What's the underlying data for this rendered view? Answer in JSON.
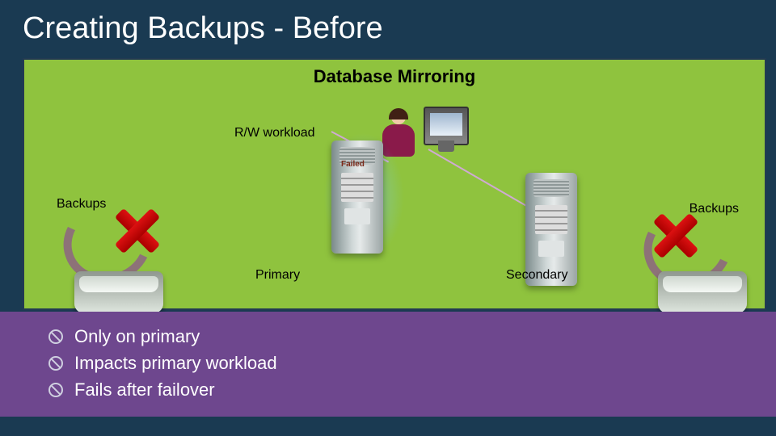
{
  "title_html": "Creating Backups - Before",
  "diagram": {
    "heading": "Database Mirroring",
    "rw_label": "R/W workload",
    "failed_label": "Failed",
    "primary_label": "Primary",
    "secondary_label": "Secondary",
    "backups_left": "Backups",
    "backups_right": "Backups"
  },
  "footer": {
    "items": [
      "Only on primary",
      "Impacts primary workload",
      "Fails after failover"
    ]
  },
  "colors": {
    "background": "#1a3a52",
    "panel": "#8fc33e",
    "footer": "#6e478e"
  }
}
